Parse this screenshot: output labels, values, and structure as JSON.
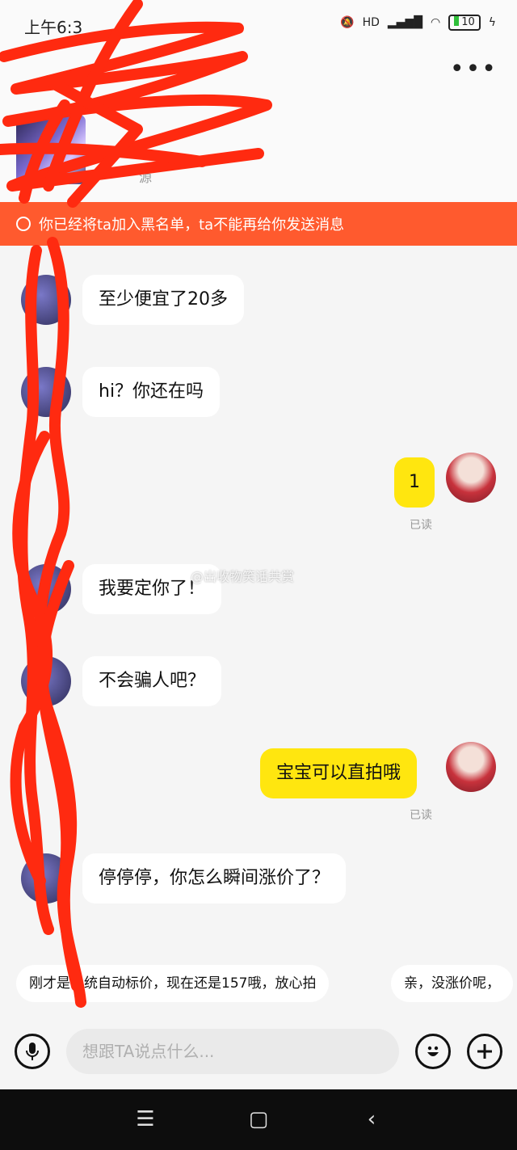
{
  "status": {
    "time": "上午6:3",
    "network": "HD",
    "battery": "10"
  },
  "header": {
    "product_info": "源"
  },
  "banner": {
    "text": "你已经将ta加入黑名单，ta不能再给你发送消息"
  },
  "messages": [
    {
      "side": "left",
      "text": "至少便宜了20多"
    },
    {
      "side": "left",
      "text": "hi？你还在吗"
    },
    {
      "side": "right",
      "text": "1",
      "status": "已读"
    },
    {
      "side": "left",
      "text": "我要定你了！"
    },
    {
      "side": "left",
      "text": "不会骗人吧？"
    },
    {
      "side": "right",
      "text": "宝宝可以直拍哦",
      "status": "已读"
    },
    {
      "side": "left",
      "text": "停停停，你怎么瞬间涨价了？"
    }
  ],
  "watermark": "@出收物笑话共赏",
  "quick_replies": [
    "刚才是系统自动标价，现在还是157哦，放心拍",
    "亲，没涨价呢，"
  ],
  "input": {
    "placeholder": "想跟TA说点什么..."
  },
  "colors": {
    "banner": "#ff5a2e",
    "my_bubble": "#ffe60f",
    "scribble": "#ff2a10"
  }
}
